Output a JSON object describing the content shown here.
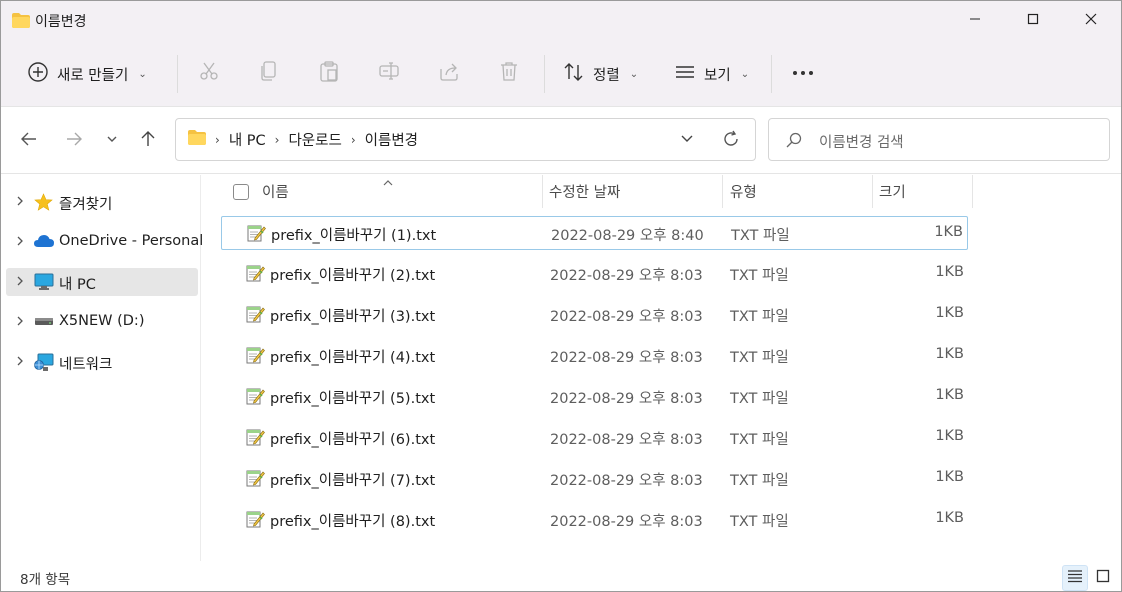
{
  "window": {
    "title": "이름변경",
    "folder_icon": "folder-icon",
    "controls": {
      "minimize": "minimize-icon",
      "maximize": "maximize-icon",
      "close": "close-icon"
    }
  },
  "toolbar": {
    "new_label": "새로 만들기",
    "sort_label": "정렬",
    "view_label": "보기",
    "icons": [
      "cut-icon",
      "copy-icon",
      "paste-icon",
      "rename-icon",
      "share-icon",
      "delete-icon",
      "more-icon"
    ]
  },
  "address": {
    "crumbs": [
      "내 PC",
      "다운로드",
      "이름변경"
    ],
    "search_placeholder": "이름변경 검색"
  },
  "sidebar": {
    "items": [
      {
        "label": "즐겨찾기",
        "icon": "star-icon",
        "selected": false
      },
      {
        "label": "OneDrive - Personal",
        "icon": "cloud-icon",
        "selected": false
      },
      {
        "label": "내 PC",
        "icon": "computer-icon",
        "selected": true
      },
      {
        "label": "X5NEW (D:)",
        "icon": "drive-icon",
        "selected": false
      },
      {
        "label": "네트워크",
        "icon": "network-icon",
        "selected": false
      }
    ]
  },
  "columns": {
    "name": "이름",
    "date": "수정한 날짜",
    "type": "유형",
    "size": "크기"
  },
  "files": [
    {
      "name": "prefix_이름바꾸기 (1).txt",
      "date": "2022-08-29 오후 8:40",
      "type": "TXT 파일",
      "size": "1KB"
    },
    {
      "name": "prefix_이름바꾸기 (2).txt",
      "date": "2022-08-29 오후 8:03",
      "type": "TXT 파일",
      "size": "1KB"
    },
    {
      "name": "prefix_이름바꾸기 (3).txt",
      "date": "2022-08-29 오후 8:03",
      "type": "TXT 파일",
      "size": "1KB"
    },
    {
      "name": "prefix_이름바꾸기 (4).txt",
      "date": "2022-08-29 오후 8:03",
      "type": "TXT 파일",
      "size": "1KB"
    },
    {
      "name": "prefix_이름바꾸기 (5).txt",
      "date": "2022-08-29 오후 8:03",
      "type": "TXT 파일",
      "size": "1KB"
    },
    {
      "name": "prefix_이름바꾸기 (6).txt",
      "date": "2022-08-29 오후 8:03",
      "type": "TXT 파일",
      "size": "1KB"
    },
    {
      "name": "prefix_이름바꾸기 (7).txt",
      "date": "2022-08-29 오후 8:03",
      "type": "TXT 파일",
      "size": "1KB"
    },
    {
      "name": "prefix_이름바꾸기 (8).txt",
      "date": "2022-08-29 오후 8:03",
      "type": "TXT 파일",
      "size": "1KB"
    }
  ],
  "status": {
    "count": "8개 항목"
  }
}
